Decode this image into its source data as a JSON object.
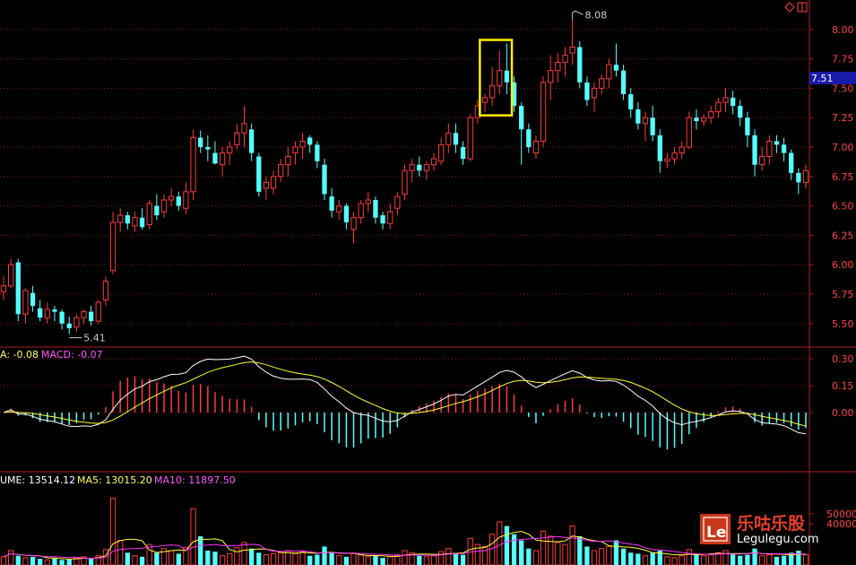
{
  "chart_data": [
    {
      "type": "candlestick",
      "title": "",
      "ylim": [
        5.3,
        8.25
      ],
      "yticks": [
        "8.00",
        "7.75",
        "7.50",
        "7.25",
        "7.00",
        "6.75",
        "6.50",
        "6.25",
        "6.00",
        "5.75",
        "5.50"
      ],
      "current_price_label": "7.51",
      "annotations": {
        "high": "8.08",
        "low": "5.41",
        "high_index": 78,
        "low_index": 9
      },
      "highlight_box": {
        "from_index": 66,
        "to_index": 69
      },
      "colors": {
        "up": "#ff3b3b",
        "down": "#54ffff",
        "grid": "#8a1c1c",
        "axis": "#b02020"
      },
      "candles": [
        [
          5.77,
          5.9,
          5.7,
          5.82
        ],
        [
          5.82,
          6.05,
          5.8,
          6.0
        ],
        [
          6.02,
          6.05,
          5.52,
          5.58
        ],
        [
          5.58,
          5.8,
          5.5,
          5.78
        ],
        [
          5.76,
          5.82,
          5.6,
          5.65
        ],
        [
          5.63,
          5.7,
          5.52,
          5.55
        ],
        [
          5.55,
          5.68,
          5.5,
          5.62
        ],
        [
          5.62,
          5.65,
          5.52,
          5.6
        ],
        [
          5.6,
          5.62,
          5.45,
          5.5
        ],
        [
          5.5,
          5.56,
          5.41,
          5.46
        ],
        [
          5.47,
          5.58,
          5.43,
          5.55
        ],
        [
          5.55,
          5.62,
          5.5,
          5.6
        ],
        [
          5.6,
          5.65,
          5.48,
          5.52
        ],
        [
          5.52,
          5.7,
          5.5,
          5.68
        ],
        [
          5.7,
          5.9,
          5.65,
          5.86
        ],
        [
          5.95,
          6.45,
          5.92,
          6.36
        ],
        [
          6.36,
          6.48,
          6.28,
          6.42
        ],
        [
          6.42,
          6.45,
          6.3,
          6.35
        ],
        [
          6.33,
          6.45,
          6.28,
          6.4
        ],
        [
          6.4,
          6.48,
          6.3,
          6.32
        ],
        [
          6.34,
          6.55,
          6.3,
          6.52
        ],
        [
          6.5,
          6.6,
          6.38,
          6.42
        ],
        [
          6.45,
          6.6,
          6.4,
          6.55
        ],
        [
          6.55,
          6.65,
          6.5,
          6.58
        ],
        [
          6.58,
          6.62,
          6.46,
          6.5
        ],
        [
          6.48,
          6.7,
          6.43,
          6.62
        ],
        [
          6.62,
          7.15,
          6.55,
          7.08
        ],
        [
          7.08,
          7.14,
          6.95,
          7.0
        ],
        [
          7.0,
          7.1,
          6.88,
          6.98
        ],
        [
          6.95,
          7.05,
          6.85,
          6.86
        ],
        [
          6.85,
          7.0,
          6.75,
          6.95
        ],
        [
          6.95,
          7.05,
          6.85,
          7.0
        ],
        [
          7.02,
          7.2,
          6.98,
          7.12
        ],
        [
          7.12,
          7.35,
          7.0,
          7.2
        ],
        [
          7.15,
          7.2,
          6.88,
          6.95
        ],
        [
          6.92,
          6.95,
          6.58,
          6.62
        ],
        [
          6.65,
          6.75,
          6.55,
          6.7
        ],
        [
          6.65,
          6.8,
          6.6,
          6.75
        ],
        [
          6.75,
          6.9,
          6.7,
          6.85
        ],
        [
          6.85,
          7.0,
          6.75,
          6.92
        ],
        [
          6.95,
          7.05,
          6.85,
          7.0
        ],
        [
          7.0,
          7.12,
          6.9,
          7.05
        ],
        [
          7.08,
          7.1,
          6.95,
          7.02
        ],
        [
          7.02,
          7.05,
          6.82,
          6.88
        ],
        [
          6.85,
          6.9,
          6.55,
          6.6
        ],
        [
          6.58,
          6.65,
          6.4,
          6.46
        ],
        [
          6.45,
          6.55,
          6.38,
          6.5
        ],
        [
          6.5,
          6.52,
          6.3,
          6.36
        ],
        [
          6.3,
          6.45,
          6.18,
          6.4
        ],
        [
          6.4,
          6.55,
          6.35,
          6.52
        ],
        [
          6.52,
          6.62,
          6.45,
          6.55
        ],
        [
          6.55,
          6.58,
          6.35,
          6.4
        ],
        [
          6.42,
          6.45,
          6.3,
          6.35
        ],
        [
          6.35,
          6.52,
          6.3,
          6.45
        ],
        [
          6.48,
          6.62,
          6.42,
          6.58
        ],
        [
          6.6,
          6.85,
          6.55,
          6.8
        ],
        [
          6.8,
          6.9,
          6.7,
          6.85
        ],
        [
          6.85,
          6.92,
          6.75,
          6.8
        ],
        [
          6.8,
          6.88,
          6.72,
          6.85
        ],
        [
          6.85,
          6.95,
          6.8,
          6.9
        ],
        [
          6.88,
          7.08,
          6.85,
          7.02
        ],
        [
          7.02,
          7.2,
          6.95,
          7.12
        ],
        [
          7.12,
          7.2,
          6.95,
          7.02
        ],
        [
          7.0,
          7.05,
          6.85,
          6.9
        ],
        [
          6.9,
          7.28,
          6.88,
          7.25
        ],
        [
          7.25,
          7.4,
          7.2,
          7.35
        ],
        [
          7.38,
          7.45,
          7.3,
          7.42
        ],
        [
          7.42,
          7.68,
          7.35,
          7.52
        ],
        [
          7.52,
          7.82,
          7.45,
          7.65
        ],
        [
          7.65,
          7.88,
          7.45,
          7.55
        ],
        [
          7.55,
          7.6,
          7.3,
          7.35
        ],
        [
          7.35,
          7.38,
          6.85,
          7.15
        ],
        [
          7.15,
          7.2,
          6.95,
          7.0
        ],
        [
          6.95,
          7.1,
          6.9,
          7.05
        ],
        [
          7.05,
          7.6,
          7.0,
          7.55
        ],
        [
          7.55,
          7.78,
          7.4,
          7.65
        ],
        [
          7.65,
          7.8,
          7.55,
          7.72
        ],
        [
          7.72,
          7.85,
          7.6,
          7.78
        ],
        [
          7.8,
          8.08,
          7.7,
          7.85
        ],
        [
          7.85,
          7.9,
          7.5,
          7.55
        ],
        [
          7.55,
          7.6,
          7.35,
          7.4
        ],
        [
          7.42,
          7.55,
          7.3,
          7.5
        ],
        [
          7.5,
          7.62,
          7.45,
          7.58
        ],
        [
          7.58,
          7.75,
          7.5,
          7.7
        ],
        [
          7.7,
          7.88,
          7.6,
          7.65
        ],
        [
          7.65,
          7.7,
          7.4,
          7.45
        ],
        [
          7.45,
          7.5,
          7.25,
          7.32
        ],
        [
          7.32,
          7.38,
          7.15,
          7.2
        ],
        [
          7.2,
          7.3,
          7.05,
          7.25
        ],
        [
          7.25,
          7.35,
          7.05,
          7.1
        ],
        [
          7.1,
          7.15,
          6.78,
          6.88
        ],
        [
          6.88,
          6.95,
          6.82,
          6.9
        ],
        [
          6.9,
          7.0,
          6.85,
          6.95
        ],
        [
          6.95,
          7.05,
          6.9,
          7.0
        ],
        [
          7.0,
          7.3,
          6.98,
          7.25
        ],
        [
          7.25,
          7.32,
          7.15,
          7.22
        ],
        [
          7.22,
          7.28,
          7.18,
          7.25
        ],
        [
          7.25,
          7.35,
          7.2,
          7.3
        ],
        [
          7.3,
          7.42,
          7.25,
          7.38
        ],
        [
          7.38,
          7.5,
          7.3,
          7.42
        ],
        [
          7.42,
          7.48,
          7.28,
          7.35
        ],
        [
          7.35,
          7.4,
          7.18,
          7.25
        ],
        [
          7.25,
          7.3,
          7.0,
          7.1
        ],
        [
          7.1,
          7.15,
          6.75,
          6.85
        ],
        [
          6.85,
          7.0,
          6.8,
          6.92
        ],
        [
          6.92,
          7.1,
          6.85,
          7.05
        ],
        [
          7.05,
          7.1,
          6.95,
          7.02
        ],
        [
          7.02,
          7.08,
          6.88,
          6.95
        ],
        [
          6.95,
          6.98,
          6.72,
          6.78
        ],
        [
          6.78,
          6.82,
          6.6,
          6.7
        ],
        [
          6.7,
          6.85,
          6.65,
          6.8
        ]
      ]
    },
    {
      "type": "macd",
      "label_prefix": "A: -0.08",
      "macd_label": "MACD: -0.07",
      "ylim": [
        -0.33,
        0.36
      ],
      "yticks": [
        "0.30",
        "0.15",
        "0.00"
      ],
      "dif_color": "#ffffff",
      "dea_color": "#ffff33",
      "bar_up_color": "#ff3b3b",
      "bar_down_color": "#54ffff"
    },
    {
      "type": "volume",
      "vol_label": "UME: 13514.12",
      "ma5_label": "MA5: 13015.20",
      "ma10_label": "MA10: 11897.50",
      "ylim": [
        0,
        90000
      ],
      "yticks": [
        "50000",
        "40000"
      ],
      "ma5_color": "#ffff33",
      "ma10_color": "#ff33ff",
      "volumes": [
        8000,
        14000,
        9000,
        7000,
        8000,
        6000,
        5000,
        7000,
        5000,
        6000,
        7000,
        8000,
        6000,
        9000,
        15000,
        65000,
        24000,
        12000,
        9000,
        8000,
        20000,
        12000,
        16000,
        14000,
        11000,
        17000,
        55000,
        28000,
        14000,
        13000,
        9000,
        11000,
        17000,
        22000,
        16000,
        12000,
        10000,
        11000,
        12000,
        14000,
        11000,
        13000,
        9000,
        10000,
        18000,
        12000,
        9000,
        8000,
        11000,
        10000,
        8000,
        9000,
        7000,
        8000,
        10000,
        14000,
        12000,
        9000,
        8000,
        9000,
        13000,
        16000,
        11000,
        10000,
        26000,
        20000,
        18000,
        30000,
        42000,
        38000,
        30000,
        24000,
        16000,
        14000,
        33000,
        28000,
        22000,
        20000,
        38000,
        28000,
        18000,
        14000,
        16000,
        18000,
        24000,
        16000,
        12000,
        11000,
        9000,
        12000,
        14000,
        8000,
        7000,
        9000,
        15000,
        11000,
        9000,
        10000,
        12000,
        14000,
        11000,
        9000,
        10000,
        16000,
        9000,
        10000,
        8000,
        9000,
        12000,
        14000,
        10000,
        13000
      ]
    }
  ],
  "watermark": {
    "brand_cn": "乐咕乐股",
    "brand_url": "Legulegu.com",
    "logo_text": "Le"
  }
}
